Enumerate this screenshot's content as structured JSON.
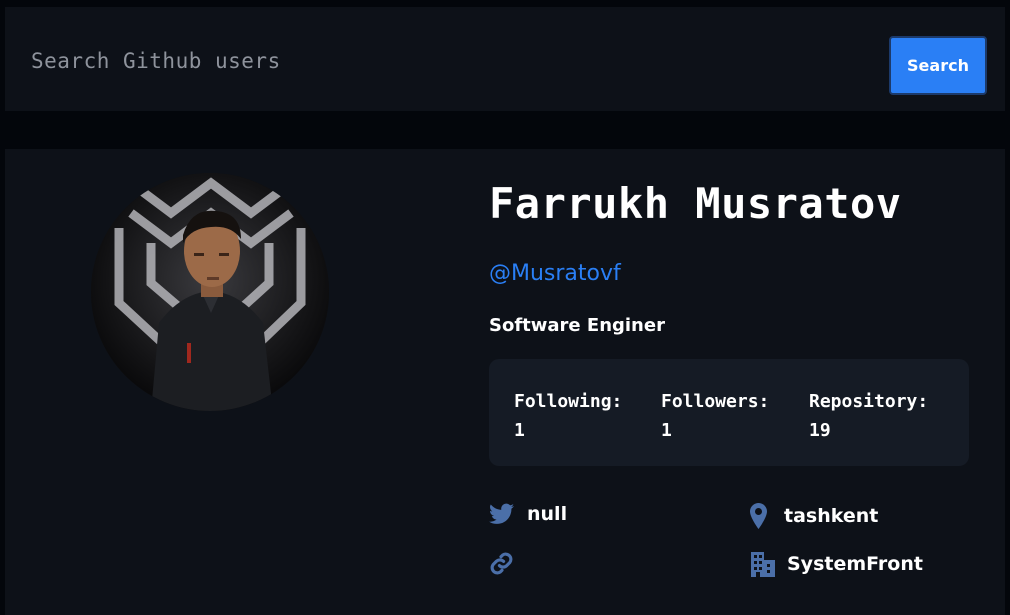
{
  "search": {
    "placeholder": "Search Github users",
    "button_label": "Search"
  },
  "profile": {
    "name": "Farrukh Musratov",
    "login": "@Musratovf",
    "bio": "Software Enginer",
    "stats": [
      {
        "label": "Following:",
        "value": "1"
      },
      {
        "label": "Followers:",
        "value": "1"
      },
      {
        "label": "Repository:",
        "value": "19"
      }
    ],
    "twitter": "null",
    "location": "tashkent",
    "blog": "",
    "company": "SystemFront"
  },
  "colors": {
    "background": "#03060b",
    "panel": "#0d1118",
    "stats_panel": "#151b25",
    "accent": "#2a7ff5",
    "icon": "#4b6fa8"
  },
  "icons": {
    "twitter": "twitter-icon",
    "location": "map-pin-icon",
    "link": "link-icon",
    "company": "building-icon"
  }
}
